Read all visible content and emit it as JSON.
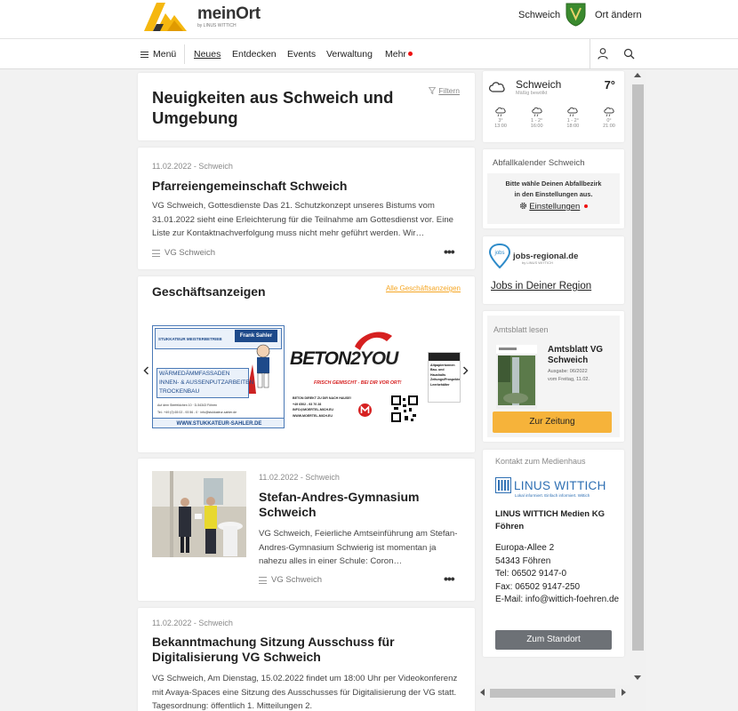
{
  "header": {
    "logo_main": "meinOrt",
    "logo_sub": "by LINUS WITTICH",
    "place": "Schweich",
    "change_place": "Ort ändern"
  },
  "nav": {
    "menu": "Menü",
    "items": [
      "Neues",
      "Entdecken",
      "Events",
      "Verwaltung",
      "Mehr"
    ],
    "active": "Neues"
  },
  "hero": {
    "title": "Neuigkeiten aus Schweich und Umgebung",
    "filter": "Filtern"
  },
  "articles": [
    {
      "meta": "11.02.2022 - Schweich",
      "title": "Pfarreiengemeinschaft Schweich",
      "text": "VG Schweich, Gottesdienste Das 21. Schutzkonzept unseres Bistums vom 31.01.2022 sieht eine Erleichterung für die Teilnahme am Gottesdienst vor. Eine Liste zur Kontaktnachverfolgung muss nicht mehr geführt werden. Wir…",
      "source": "VG Schweich"
    },
    {
      "meta": "11.02.2022 - Schweich",
      "title": "Stefan-Andres-Gymnasium Schweich",
      "text": "VG Schweich, Feierliche Amtseinführung am Stefan-Andres-Gymnasium Schwierig ist momentan ja nahezu alles in einer Schule: Coron…",
      "source": "VG Schweich"
    },
    {
      "meta": "11.02.2022 - Schweich",
      "title": "Bekanntmachung Sitzung Ausschuss für Digitalisierung VG Schweich",
      "text": "VG Schweich, Am Dienstag, 15.02.2022 findet um 18:00 Uhr per Videokonferenz mit Avaya-Spaces eine Sitzung des Ausschusses für Digitalisierung der VG statt. Tagesordnung: öffentlich 1. Mitteilungen 2."
    }
  ],
  "ads": {
    "title": "Geschäftsanzeigen",
    "all_link": "Alle Geschäftsanzeigen",
    "ad1": {
      "top": "Stukkateur Meisterbetrieb",
      "name": "Frank Sahler",
      "line1": "Wärmedämmfassaden",
      "line2": "Innen- & Außenputzarbeiten",
      "line3": "Trockenbau",
      "addr": "Auf dem Sterfeldchen 10 · D-54343 Föhren",
      "tel": "Tel.: +49 (0) 65 02 - 93 56 - 0 · info@stukkateur-sahler.de",
      "url": "www.stukkateur-sahler.de"
    },
    "ad2": {
      "brand_a": "BETON",
      "brand_b": "2YOU",
      "slogan": "FRISCH GEMISCHT - BEI DIR VOR ORT!",
      "l1": "BETON DIREKT ZU DIR NACH HAUSE!",
      "l2": "+49 6502 - 93 70 28",
      "l3": "INFO@MOERTEL-MICH.EU",
      "l4": "WWW.MOERTEL-MICH.EU"
    },
    "ad3": {
      "l1": "Altpapiertonnen",
      "l2": "Bau- und",
      "l3": "Haushalts",
      "l4": "Zeitungs/Prospekte",
      "l5": "Leerbehälter"
    }
  },
  "weather": {
    "place": "Schweich",
    "condition": "Mäßig bewölkt",
    "temp": "7°",
    "hours": [
      {
        "temp": "3°",
        "time": "13:00"
      },
      {
        "temp": "1 - 2°",
        "time": "16:00"
      },
      {
        "temp": "1 - 2°",
        "time": "18:00"
      },
      {
        "temp": "0°",
        "time": "21:00"
      }
    ]
  },
  "abfall": {
    "title": "Abfallkalender Schweich",
    "msg1": "Bitte wähle Deinen Abfallbezirk",
    "msg2": "in den Einstellungen aus.",
    "settings": "Einstellungen"
  },
  "jobs": {
    "brand": "jobs-regional.de",
    "tag": "by LINUS WITTICH",
    "cta": "Jobs in Deiner Region"
  },
  "amtsblatt": {
    "label": "Amtsblatt lesen",
    "title": "Amtsblatt VG Schweich",
    "issue": "Ausgabe: 06/2022",
    "date": "vom Freitag, 11.02.",
    "button": "Zur Zeitung"
  },
  "kontakt": {
    "label": "Kontakt zum Medienhaus",
    "brand": "LINUS WITTICH",
    "brand_sub": "Lokal informiert. Einfach informiert. Wittich",
    "company": "LINUS WITTICH Medien KG Föhren",
    "street": "Europa-Allee 2",
    "city": "54343 Föhren",
    "tel": "Tel: 06502 9147-0",
    "fax": "Fax: 06502 9147-250",
    "email": "E-Mail: info@wittich-foehren.de",
    "button": "Zum Standort"
  },
  "colors": {
    "accent": "#f6b33a",
    "brand_blue": "#2e6fb3",
    "logo_yellow": "#f5b70f",
    "notice_red": "#e11111"
  }
}
